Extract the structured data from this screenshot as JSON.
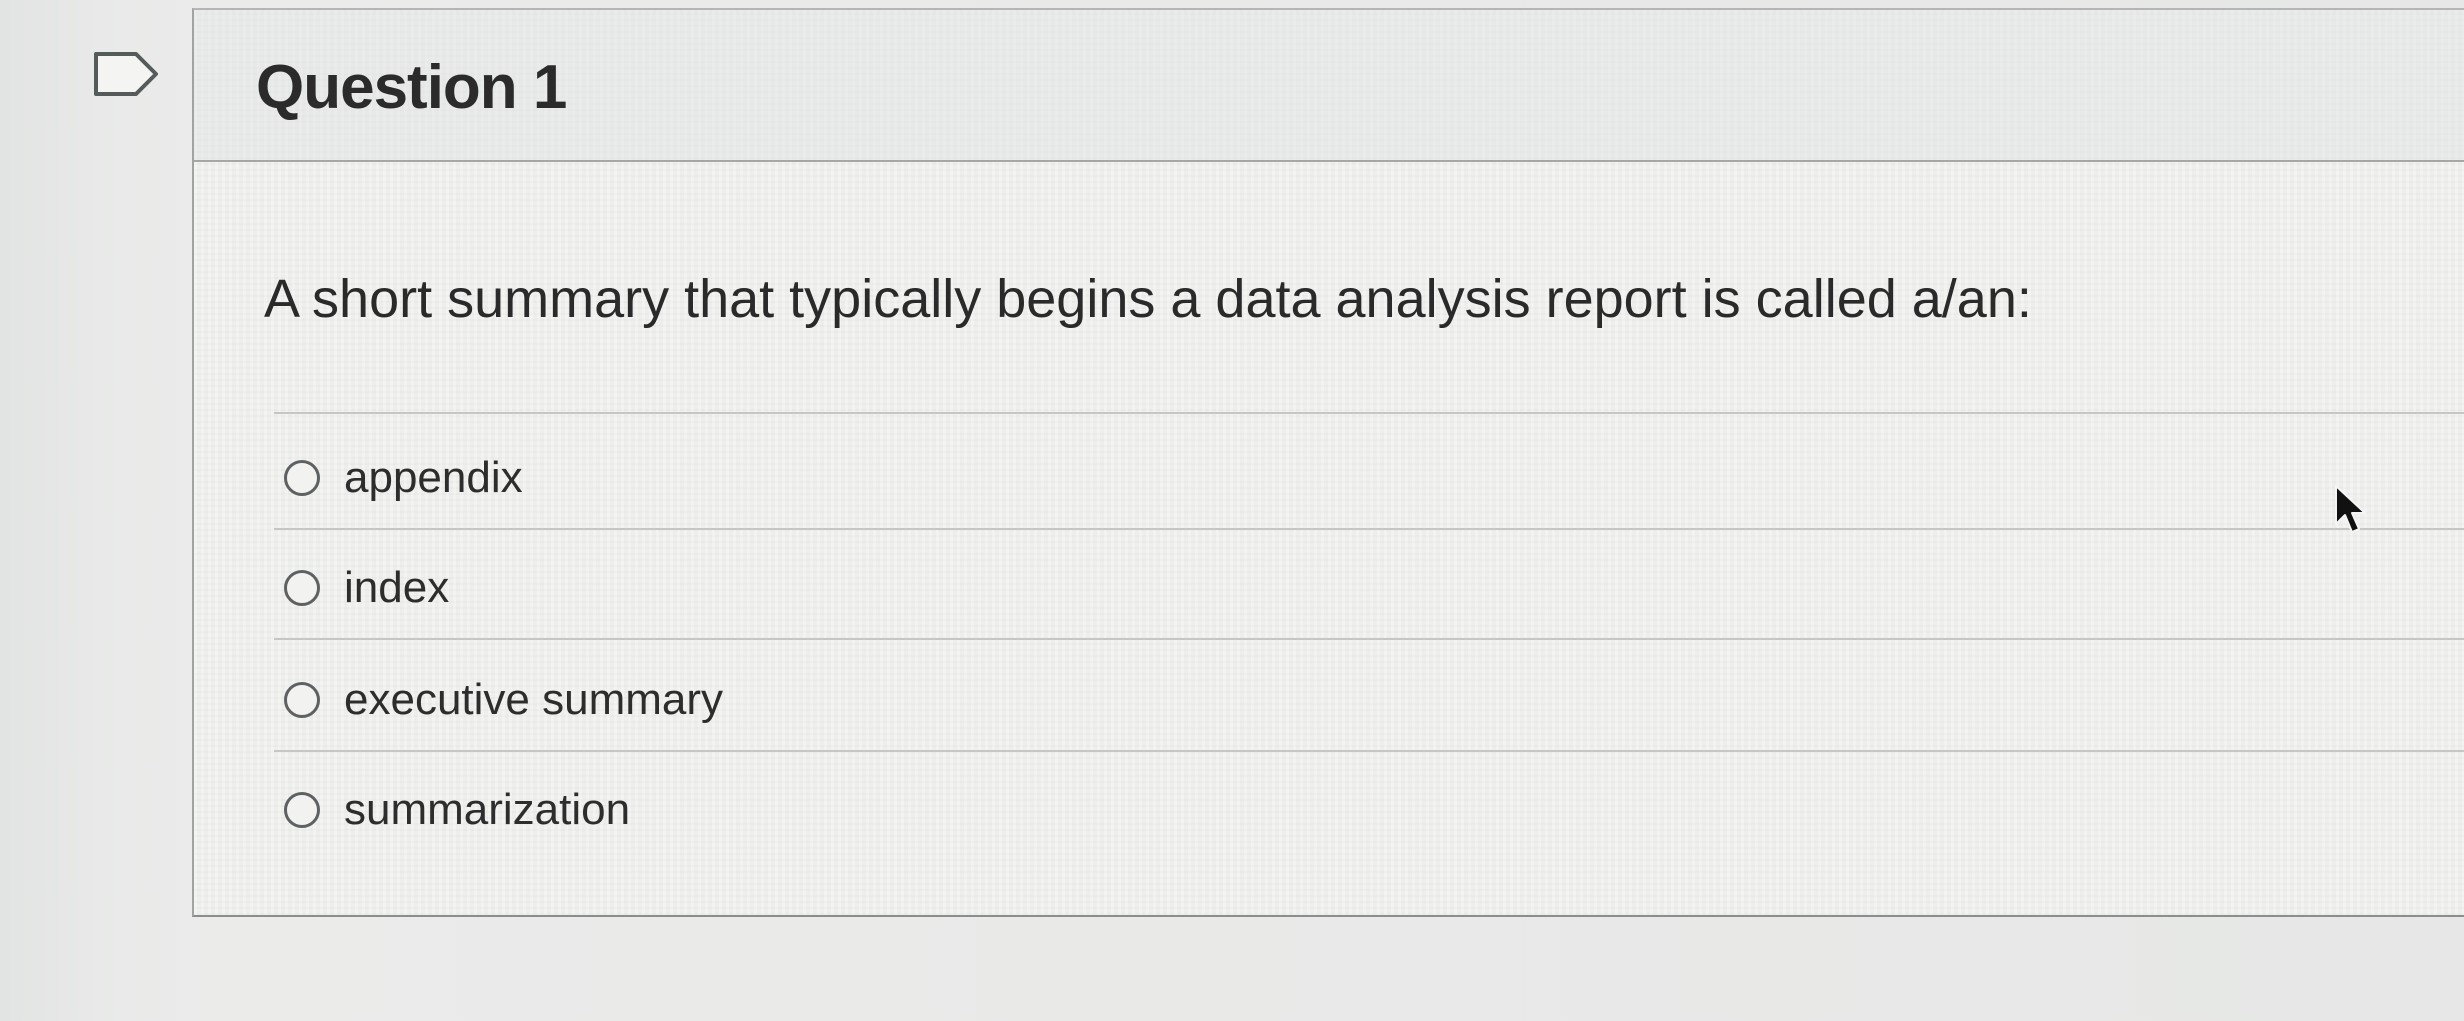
{
  "question": {
    "title": "Question 1",
    "prompt": "A short summary that typically begins a data analysis report is called a/an:",
    "answers": [
      {
        "label": "appendix",
        "selected": false
      },
      {
        "label": "index",
        "selected": false
      },
      {
        "label": "executive summary",
        "selected": false
      },
      {
        "label": "summarization",
        "selected": false
      }
    ]
  },
  "icons": {
    "flag": "flag-icon",
    "cursor": "mouse-pointer-icon",
    "radio": "radio-unselected-icon"
  },
  "colors": {
    "text": "#2b2b2b",
    "radio_border": "#5d6161",
    "divider": "#c4c7c6"
  }
}
